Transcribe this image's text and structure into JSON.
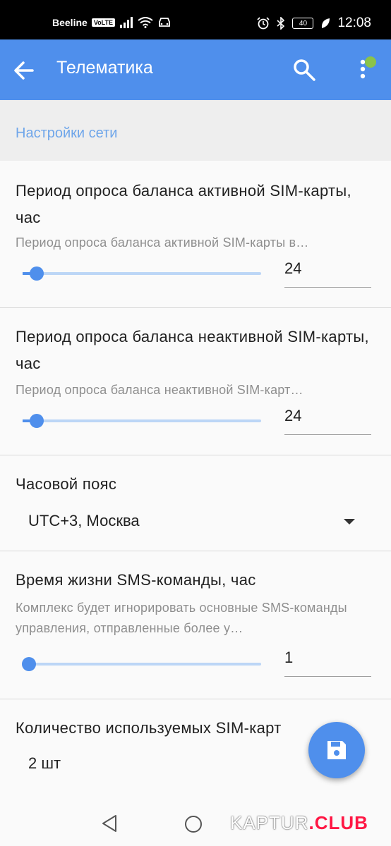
{
  "status_bar": {
    "carrier": "Beeline",
    "volte": "VoLTE",
    "battery": "40",
    "time": "12:08"
  },
  "app_bar": {
    "title": "Телематика",
    "icons": [
      "arrow-back-icon",
      "search-icon",
      "more-vert-icon"
    ]
  },
  "section": {
    "title": "Настройки сети"
  },
  "prefs": [
    {
      "title": "Период опроса баланса активной SIM-карты, час",
      "subtitle": "Период опроса баланса активной SIM-карты в…",
      "value": "24",
      "slider_fraction": 0.04
    },
    {
      "title": "Период опроса баланса неактивной SIM-карты, час",
      "subtitle": "Период опроса баланса неактивной SIM-карт…",
      "value": "24",
      "slider_fraction": 0.04
    },
    {
      "title": "Часовой пояс",
      "selected": "UTC+3, Москва"
    },
    {
      "title": "Время жизни SMS-команды, час",
      "subtitle": "Комплекс будет игнорировать основные SMS-команды управления, отправленные более у…",
      "value": "1",
      "slider_fraction": 0.0
    },
    {
      "title": "Количество используемых SIM-карт",
      "selected": "2 шт"
    }
  ],
  "fab": {
    "icon": "save-icon"
  },
  "watermark": {
    "part1": "KAPTUR",
    "part2": ".CLUB"
  },
  "colors": {
    "primary": "#4f8fec",
    "section_title": "#6fa6ea",
    "track": "#bcd6f6"
  }
}
